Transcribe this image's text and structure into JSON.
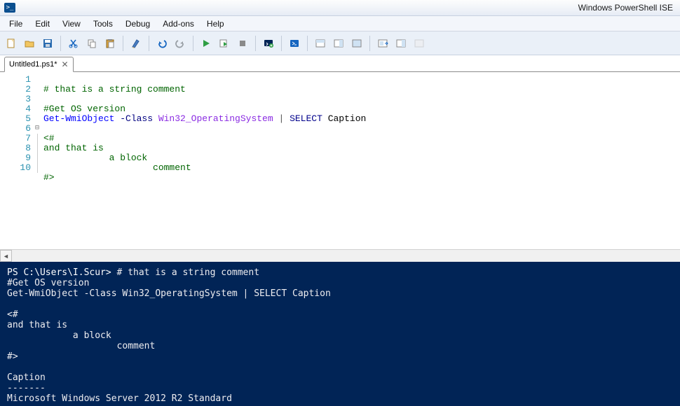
{
  "window": {
    "title": "Windows PowerShell ISE"
  },
  "menu": {
    "file": "File",
    "edit": "Edit",
    "view": "View",
    "tools": "Tools",
    "debug": "Debug",
    "addons": "Add-ons",
    "help": "Help"
  },
  "tab": {
    "label": "Untitled1.ps1*",
    "close": "✕"
  },
  "lines": {
    "l1": "1",
    "l2": "2",
    "l3": "3",
    "l4": "4",
    "l5": "5",
    "l6": "6",
    "l7": "7",
    "l8": "8",
    "l9": "9",
    "l10": "10"
  },
  "fold": {
    "l6": "⊟"
  },
  "code": {
    "l1": "# that is a string comment",
    "l2": "",
    "l3": "#Get OS version",
    "l4_cmd": "Get-WmiObject",
    "l4_param": " -Class",
    "l4_type": " Win32_OperatingSystem",
    "l4_pipe": " | ",
    "l4_select": "SELECT",
    "l4_prop": " Caption",
    "l5": "",
    "l6": "<#",
    "l7": "and that is",
    "l8": "            a block",
    "l9": "                    comment",
    "l10": "#>"
  },
  "console": {
    "prompt": "PS C:\\Users\\I.Scur> ",
    "cmd_line0": "# that is a string comment",
    "body": "\n#Get OS version\nGet-WmiObject -Class Win32_OperatingSystem | SELECT Caption\n\n<#\nand that is\n            a block\n                    comment\n#>\n\nCaption\n-------\nMicrosoft Windows Server 2012 R2 Standard"
  }
}
